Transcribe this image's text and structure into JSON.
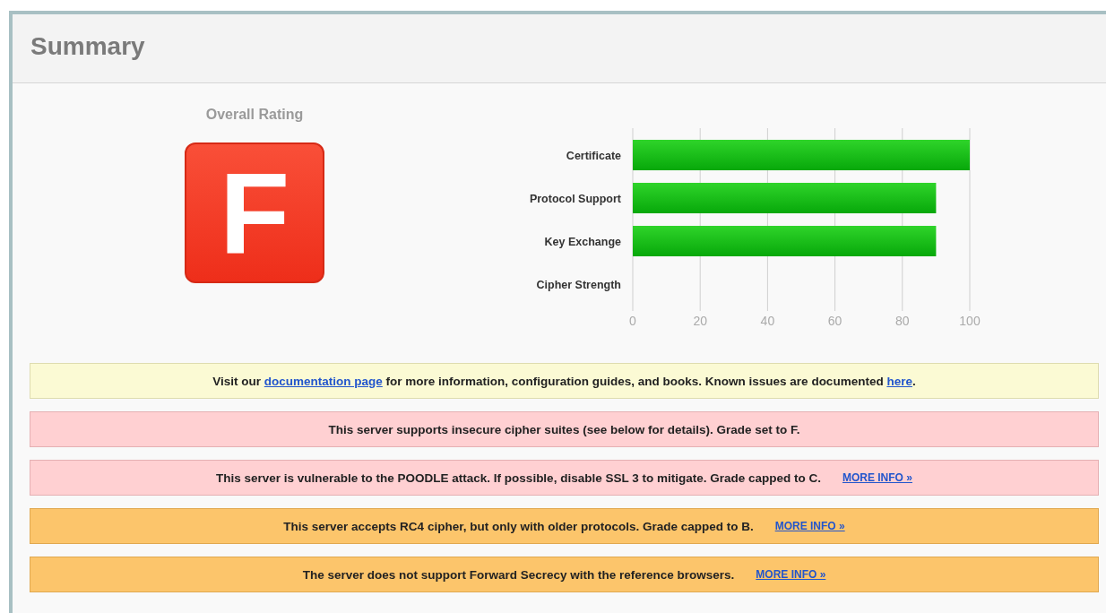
{
  "header": {
    "title": "Summary"
  },
  "rating": {
    "label": "Overall Rating",
    "grade": "F"
  },
  "chart_data": {
    "type": "bar",
    "orientation": "horizontal",
    "categories": [
      "Certificate",
      "Protocol Support",
      "Key Exchange",
      "Cipher Strength"
    ],
    "values": [
      100,
      90,
      90,
      0
    ],
    "xlim": [
      0,
      100
    ],
    "xticks": [
      0,
      20,
      40,
      60,
      80,
      100
    ],
    "grid": true
  },
  "notices": [
    {
      "kind": "info",
      "segments": [
        {
          "kind": "text",
          "text": "Visit our "
        },
        {
          "kind": "link",
          "text": "documentation page"
        },
        {
          "kind": "text",
          "text": " for more information, configuration guides, and books. Known issues are documented "
        },
        {
          "kind": "link",
          "text": "here"
        },
        {
          "kind": "text",
          "text": "."
        }
      ]
    },
    {
      "kind": "error",
      "segments": [
        {
          "kind": "text",
          "text": "This server supports insecure cipher suites (see below for details). Grade set to F."
        }
      ]
    },
    {
      "kind": "error",
      "segments": [
        {
          "kind": "text",
          "text": "This server is vulnerable to the POODLE attack. If possible, disable SSL 3 to mitigate. Grade capped to C."
        }
      ],
      "more_info": "MORE INFO »"
    },
    {
      "kind": "warning",
      "segments": [
        {
          "kind": "text",
          "text": "This server accepts RC4 cipher, but only with older protocols. Grade capped to B."
        }
      ],
      "more_info": "MORE INFO »"
    },
    {
      "kind": "warning",
      "segments": [
        {
          "kind": "text",
          "text": "The server does not support Forward Secrecy with the reference browsers."
        }
      ],
      "more_info": "MORE INFO »"
    }
  ]
}
